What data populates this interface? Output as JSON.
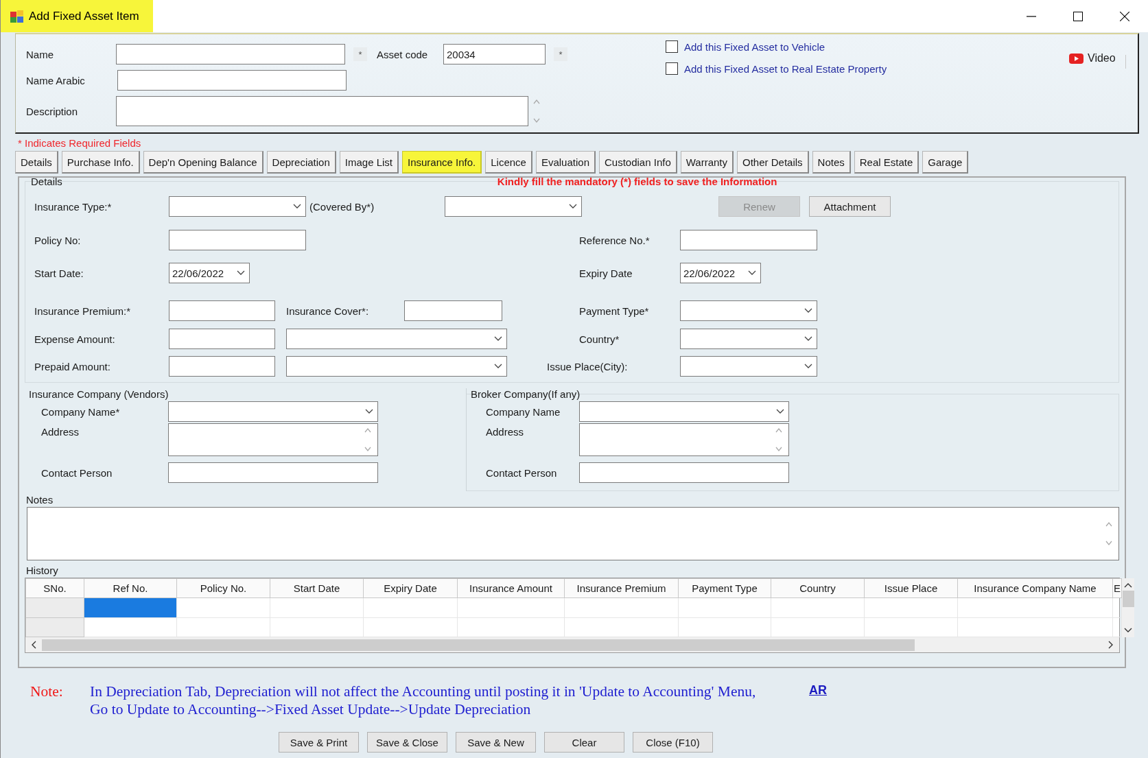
{
  "window": {
    "title": "Add Fixed Asset Item"
  },
  "header": {
    "rows": [
      [
        {
          "kind": "label",
          "text": "Name"
        },
        {
          "kind": "text"
        },
        {
          "kind": "mark",
          "text": "*"
        },
        {
          "kind": "label",
          "text": "Asset code"
        },
        {
          "kind": "text",
          "value": "20034"
        },
        {
          "kind": "mark",
          "text": "*"
        }
      ],
      [
        {
          "kind": "label",
          "text": "Name Arabic"
        },
        {
          "kind": "text"
        }
      ],
      [
        {
          "kind": "label",
          "text": "Description"
        },
        {
          "kind": "memo"
        }
      ]
    ],
    "checkboxes": [
      {
        "label": "Add this Fixed Asset to Vehicle",
        "checked": false
      },
      {
        "label": "Add this Fixed Asset to Real Estate Property",
        "checked": false
      }
    ],
    "video_link": "Video"
  },
  "required_note": "* Indicates Required Fields",
  "tabs": [
    {
      "label": "Details",
      "selected": false
    },
    {
      "label": "Purchase Info.",
      "selected": false
    },
    {
      "label": "Dep'n Opening Balance",
      "selected": false
    },
    {
      "label": "Depreciation",
      "selected": false
    },
    {
      "label": "Image List",
      "selected": false
    },
    {
      "label": "Insurance Info.",
      "selected": true
    },
    {
      "label": "Licence",
      "selected": false
    },
    {
      "label": "Evaluation",
      "selected": false
    },
    {
      "label": "Custodian Info",
      "selected": false
    },
    {
      "label": "Warranty",
      "selected": false
    },
    {
      "label": "Other Details",
      "selected": false
    },
    {
      "label": "Notes",
      "selected": false
    },
    {
      "label": "Real Estate",
      "selected": false
    },
    {
      "label": "Garage",
      "selected": false
    }
  ],
  "details": {
    "legend": "Details",
    "warning": "Kindly fill the mandatory (*) fields to save the Information",
    "rows": [
      {
        "left": [
          {
            "kind": "label",
            "text": "Insurance Type:*"
          },
          {
            "kind": "combo"
          },
          {
            "kind": "label",
            "text": "(Covered By*)"
          },
          {
            "kind": "combo"
          }
        ],
        "right": [
          {
            "kind": "button",
            "text": "Renew",
            "disabled": true
          },
          {
            "kind": "button",
            "text": "Attachment",
            "disabled": false
          }
        ]
      },
      {
        "left": [
          {
            "kind": "label",
            "text": "Policy No:"
          },
          {
            "kind": "text"
          }
        ],
        "right": [
          {
            "kind": "label",
            "text": "Reference No.*"
          },
          {
            "kind": "text"
          }
        ]
      },
      {
        "left": [
          {
            "kind": "label",
            "text": "Start Date:"
          },
          {
            "kind": "date",
            "value": "22/06/2022"
          }
        ],
        "right": [
          {
            "kind": "label",
            "text": "Expiry Date"
          },
          {
            "kind": "date",
            "value": "22/06/2022"
          }
        ]
      },
      {
        "left": [
          {
            "kind": "label",
            "text": "Insurance Premium:*"
          },
          {
            "kind": "text"
          },
          {
            "kind": "label",
            "text": "Insurance Cover*:"
          },
          {
            "kind": "text"
          }
        ],
        "right": [
          {
            "kind": "label",
            "text": "Payment Type*"
          },
          {
            "kind": "combo"
          }
        ]
      },
      {
        "left": [
          {
            "kind": "label",
            "text": "Expense Amount:"
          },
          {
            "kind": "text"
          },
          {
            "kind": "combo"
          }
        ],
        "right": [
          {
            "kind": "label",
            "text": "Country*"
          },
          {
            "kind": "combo"
          }
        ]
      },
      {
        "left": [
          {
            "kind": "label",
            "text": "Prepaid Amount:"
          },
          {
            "kind": "text"
          },
          {
            "kind": "combo"
          }
        ],
        "right": [
          {
            "kind": "label",
            "text": "Issue Place(City):"
          },
          {
            "kind": "combo"
          }
        ]
      }
    ]
  },
  "companies": [
    {
      "legend": "Insurance Company (Vendors)",
      "fields": [
        {
          "kind": "combo",
          "label": "Company Name*"
        },
        {
          "kind": "memo",
          "label": "Address"
        },
        {
          "kind": "text",
          "label": "Contact Person"
        }
      ]
    },
    {
      "legend": "Broker Company(If any)",
      "fields": [
        {
          "kind": "combo",
          "label": "Company Name"
        },
        {
          "kind": "memo",
          "label": "Address"
        },
        {
          "kind": "text",
          "label": "Contact Person"
        }
      ]
    }
  ],
  "notes": {
    "label": "Notes"
  },
  "history": {
    "label": "History",
    "columns": [
      "SNo.",
      "Ref No.",
      "Policy No.",
      "Start Date",
      "Expiry Date",
      "Insurance Amount",
      "Insurance Premium",
      "Payment Type",
      "Country",
      "Issue Place",
      "Insurance Company Name",
      "E"
    ],
    "rows": [
      {
        "selected": true
      },
      {
        "selected": false
      }
    ]
  },
  "footer_note": {
    "label": "Note:",
    "text": "In Depreciation Tab, Depreciation will not affect the Accounting until posting it in 'Update to Accounting' Menu,\nGo to Update to Accounting-->Fixed Asset Update-->Update Depreciation",
    "link": "AR"
  },
  "buttons": [
    "Save & Print",
    "Save & Close",
    "Save & New",
    "Clear",
    "Close (F10)"
  ]
}
